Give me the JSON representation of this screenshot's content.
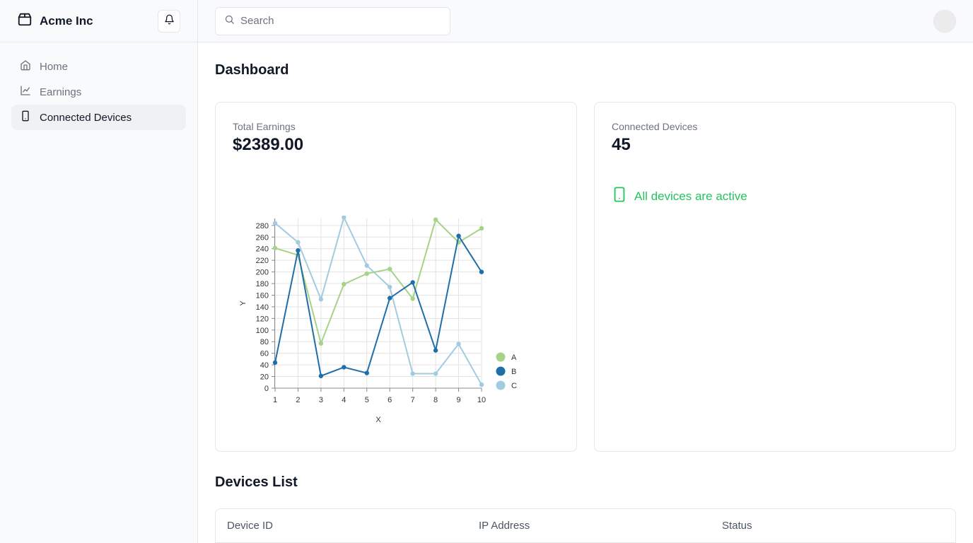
{
  "brand": {
    "name": "Acme Inc",
    "logo_icon": "package-icon",
    "bell_icon": "bell-icon"
  },
  "nav": {
    "items": [
      {
        "label": "Home",
        "icon": "home-icon",
        "active": false
      },
      {
        "label": "Earnings",
        "icon": "line-chart-icon",
        "active": false
      },
      {
        "label": "Connected Devices",
        "icon": "smartphone-icon",
        "active": true
      }
    ]
  },
  "search": {
    "placeholder": "Search",
    "value": ""
  },
  "page": {
    "title": "Dashboard"
  },
  "earnings_card": {
    "label": "Total Earnings",
    "value": "$2389.00"
  },
  "devices_card": {
    "label": "Connected Devices",
    "value": "45",
    "status": "All devices are active",
    "status_color": "#22c55e"
  },
  "devices_list": {
    "title": "Devices List",
    "columns": [
      "Device ID",
      "IP Address",
      "Status"
    ]
  },
  "chart_data": {
    "type": "line",
    "xlabel": "X",
    "ylabel": "Y",
    "x": [
      1,
      2,
      3,
      4,
      5,
      6,
      7,
      8,
      9,
      10
    ],
    "ylim": [
      0,
      280
    ],
    "yticks": [
      0,
      20,
      40,
      60,
      80,
      100,
      120,
      140,
      160,
      180,
      200,
      220,
      240,
      260,
      280
    ],
    "grid": true,
    "legend": "right",
    "series": [
      {
        "name": "A",
        "color": "#a6d388",
        "values": [
          241,
          229,
          77,
          179,
          197,
          205,
          154,
          290,
          251,
          275
        ]
      },
      {
        "name": "B",
        "color": "#1f6ea8",
        "values": [
          44,
          237,
          21,
          36,
          26,
          155,
          182,
          65,
          262,
          200
        ]
      },
      {
        "name": "C",
        "color": "#a3cbe0",
        "values": [
          284,
          251,
          153,
          294,
          211,
          174,
          25,
          25,
          76,
          6
        ]
      }
    ]
  }
}
